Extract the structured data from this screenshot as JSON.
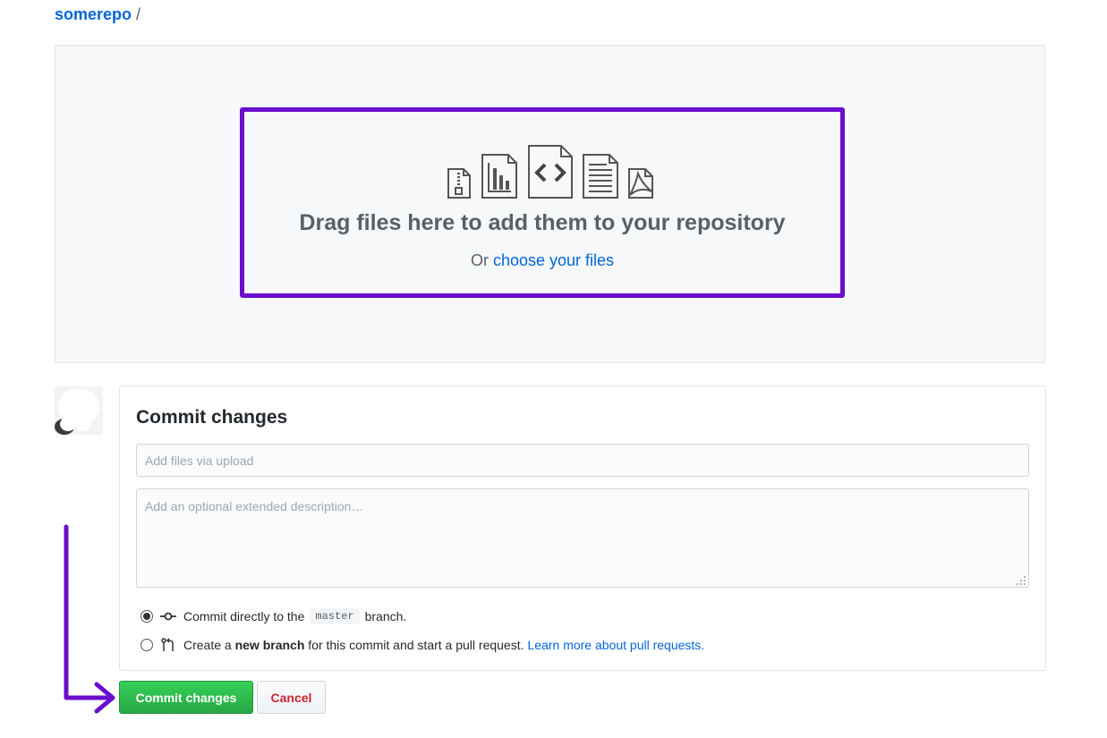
{
  "breadcrumb": {
    "repo": "somerepo",
    "separator": "/"
  },
  "dropzone": {
    "title": "Drag files here to add them to your repository",
    "or_text": "Or",
    "choose_link": "choose your files",
    "icons": [
      "file-zip-icon",
      "file-chart-icon",
      "file-code-icon",
      "file-text-icon",
      "file-pdf-icon"
    ]
  },
  "commit": {
    "title": "Commit changes",
    "summary_placeholder": "Add files via upload",
    "description_placeholder": "Add an optional extended description…",
    "option_direct": {
      "prefix": "Commit directly to the",
      "branch": "master",
      "suffix": "branch.",
      "selected": true
    },
    "option_new_branch": {
      "prefix": "Create a",
      "bold": "new branch",
      "suffix": "for this commit and start a pull request.",
      "link": "Learn more about pull requests.",
      "selected": false
    }
  },
  "buttons": {
    "commit": "Commit changes",
    "cancel": "Cancel"
  },
  "colors": {
    "highlight": "#6a0dcc",
    "link": "#0366d6",
    "commit_button": "#28a745",
    "cancel_text": "#cb2431"
  }
}
